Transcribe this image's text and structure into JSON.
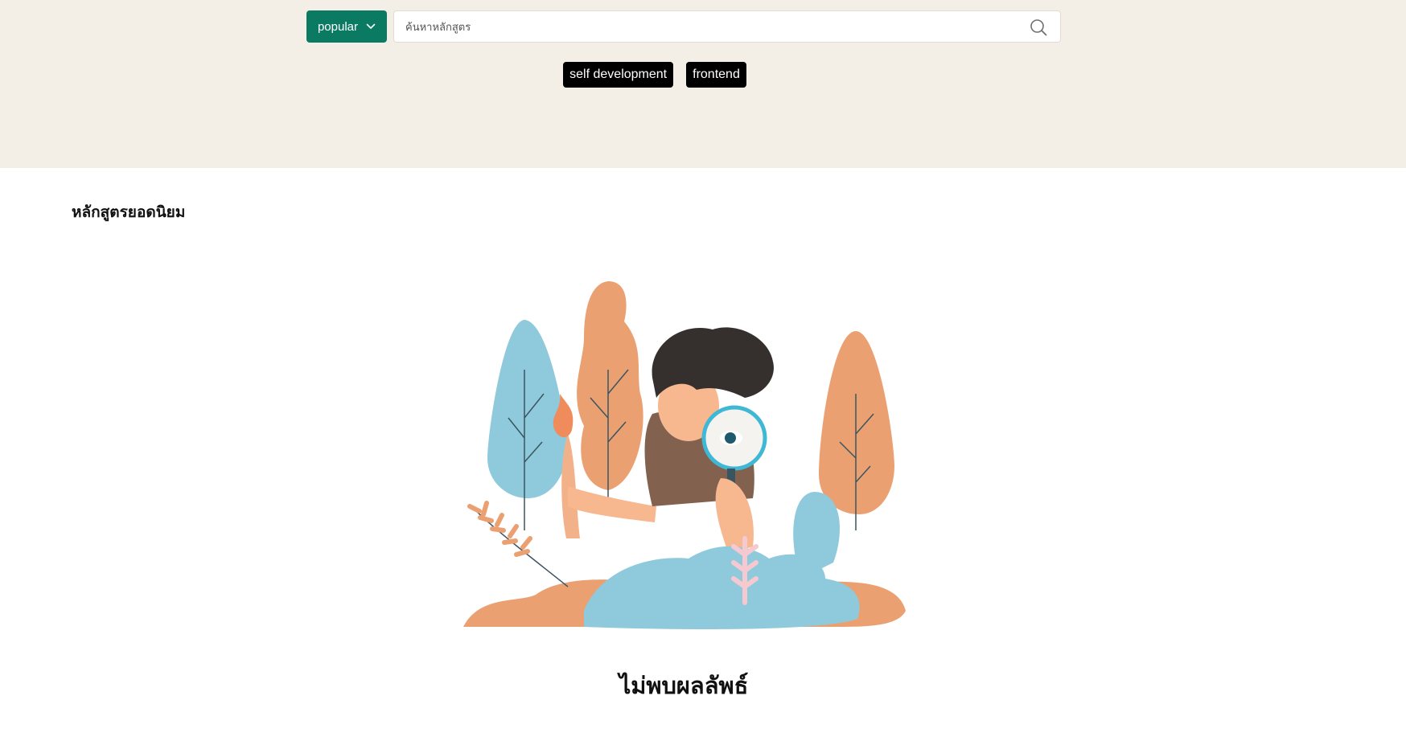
{
  "filters": {
    "sort_label": "popular",
    "search_placeholder": "ค้นหาหลักสูตร",
    "tags": [
      "self development",
      "frontend"
    ]
  },
  "section": {
    "title": "หลักสูตรยอดนิยม"
  },
  "empty_state": {
    "message": "ไม่พบผลลัพธ์"
  },
  "colors": {
    "background_band": "#f3efe7",
    "accent": "#0b7a63",
    "tag_background": "#000000",
    "illustration_blue": "#8ecadb",
    "illustration_peach": "#eba072",
    "illustration_brown": "#82614f"
  },
  "icons": {
    "sort_chevron": "chevron-down-icon",
    "search": "search-icon"
  }
}
